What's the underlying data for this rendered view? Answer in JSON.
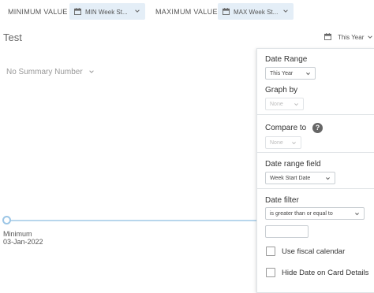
{
  "topbar": {
    "min_label": "MINIMUM VALUE",
    "min_field": "MIN Week St...",
    "max_label": "MAXIMUM VALUE",
    "max_field": "MAX Week St..."
  },
  "card": {
    "title": "Test",
    "date_selector": "This Year",
    "summary_placeholder": "No Summary Number"
  },
  "slider": {
    "min_label": "Minimum",
    "min_date": "03-Jan-2022"
  },
  "panel": {
    "date_range_title": "Date Range",
    "date_range_value": "This Year",
    "graph_by_title": "Graph by",
    "graph_by_value": "None",
    "compare_title": "Compare to",
    "compare_value": "None",
    "date_field_title": "Date range field",
    "date_field_value": "Week Start Date",
    "date_filter_title": "Date filter",
    "date_filter_value": "is greater than or equal to",
    "date_filter_input": "",
    "fiscal_label": "Use fiscal calendar",
    "hide_date_label": "Hide Date on Card Details"
  },
  "icons": {
    "calendar": "calendar-icon",
    "chevron": "chevron-down-icon",
    "help": "question-circle-icon"
  },
  "colors": {
    "chip_bg": "#e4eef7",
    "slider": "#9cc6e6",
    "help_bg": "#666666"
  }
}
